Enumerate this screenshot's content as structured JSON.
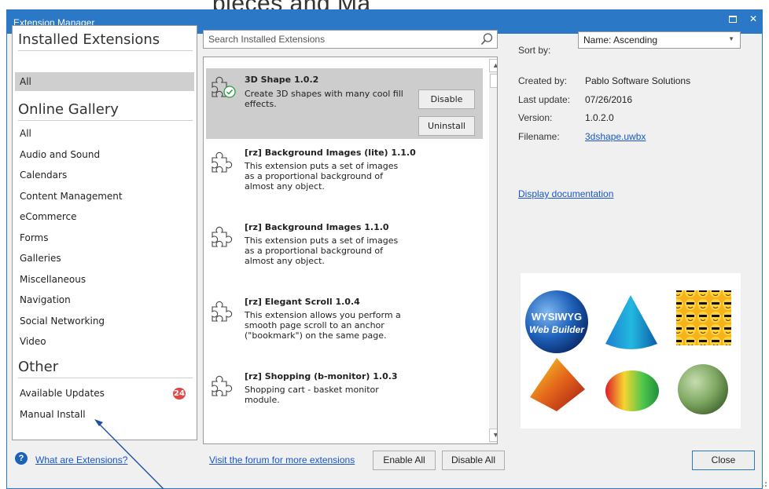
{
  "window": {
    "title": "Extension Manager",
    "accent": "#2b78c6"
  },
  "categories": {
    "installed_heading": "Installed Extensions",
    "installed_items": [
      {
        "label": "All",
        "selected": true
      }
    ],
    "gallery_heading": "Online Gallery",
    "gallery_items": [
      {
        "label": "All"
      },
      {
        "label": "Audio and Sound"
      },
      {
        "label": "Calendars"
      },
      {
        "label": "Content Management"
      },
      {
        "label": "eCommerce"
      },
      {
        "label": "Forms"
      },
      {
        "label": "Galleries"
      },
      {
        "label": "Miscellaneous"
      },
      {
        "label": "Navigation"
      },
      {
        "label": "Social Networking"
      },
      {
        "label": "Video"
      }
    ],
    "other_heading": "Other",
    "other_items": [
      {
        "label": "Available Updates",
        "badge": "24"
      },
      {
        "label": "Manual Install"
      }
    ]
  },
  "search": {
    "placeholder": "Search Installed Extensions"
  },
  "extensions": [
    {
      "name": "3D Shape 1.0.2",
      "desc": [
        "Create 3D shapes with many cool fill",
        "effects."
      ],
      "selected": true,
      "installed": true
    },
    {
      "name": "[rz] Background Images (lite) 1.1.0",
      "desc": [
        "This extension puts a set of images",
        "as a proportional background of",
        "almost any object."
      ]
    },
    {
      "name": "[rz] Background Images 1.1.0",
      "desc": [
        "This extension puts a set of images",
        "as a proportional background of",
        "almost any object."
      ]
    },
    {
      "name": "[rz] Elegant Scroll 1.0.4",
      "desc": [
        "This extension allows you perform a",
        "smooth page scroll to an anchor",
        "(\"bookmark\") on the same page."
      ]
    },
    {
      "name": "[rz] Shopping (b-monitor) 1.0.3",
      "desc": [
        "Shopping cart - basket monitor",
        "module."
      ]
    }
  ],
  "item_buttons": {
    "disable": "Disable",
    "uninstall": "Uninstall"
  },
  "details": {
    "sort_label": "Sort by:",
    "sort_value": "Name: Ascending",
    "created_by_label": "Created by:",
    "created_by": "Pablo Software Solutions",
    "last_update_label": "Last update:",
    "last_update": "07/26/2016",
    "version_label": "Version:",
    "version": "1.0.2.0",
    "filename_label": "Filename:",
    "filename": "3dshape.uwbx",
    "documentation_link": "Display documentation"
  },
  "preview": {
    "logo_text_1": "WYSIWYG",
    "logo_text_2": "Web Builder"
  },
  "footer": {
    "help_link": "What are Extensions?",
    "forum_link": "Visit the forum for more extensions",
    "enable_all": "Enable All",
    "disable_all": "Disable All",
    "close": "Close"
  },
  "background_text": "pieces and Ma"
}
